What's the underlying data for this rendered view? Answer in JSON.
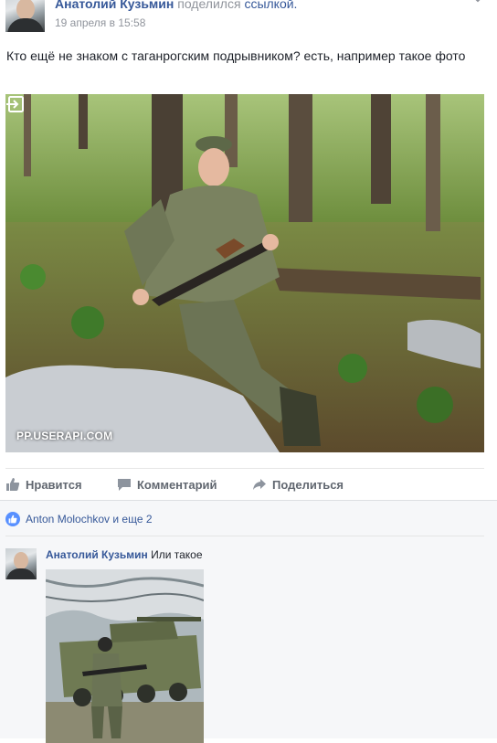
{
  "post": {
    "author": "Анатолий Кузьмин",
    "action": "поделился",
    "action_link": "ссылкой.",
    "date": "19 апреля в 15:58",
    "text": "Кто ещё не знаком с таганрогским подрывником? есть, например такое фото",
    "photo_domain": "PP.USERAPI.COM"
  },
  "actions": {
    "like": "Нравится",
    "comment": "Комментарий",
    "share": "Поделиться"
  },
  "likes": {
    "text": "Anton Molochkov и еще 2"
  },
  "comment": {
    "author": "Анатолий Кузьмин",
    "text": "Или такое"
  },
  "colors": {
    "link": "#365899",
    "meta": "#90949c",
    "action": "#616770",
    "like_bubble": "#5890ff",
    "comments_bg": "#f6f7f9"
  },
  "icons": [
    "chevron-down-icon",
    "external-link-icon",
    "thumbs-up-icon",
    "comment-icon",
    "share-arrow-icon",
    "like-bubble-icon"
  ]
}
